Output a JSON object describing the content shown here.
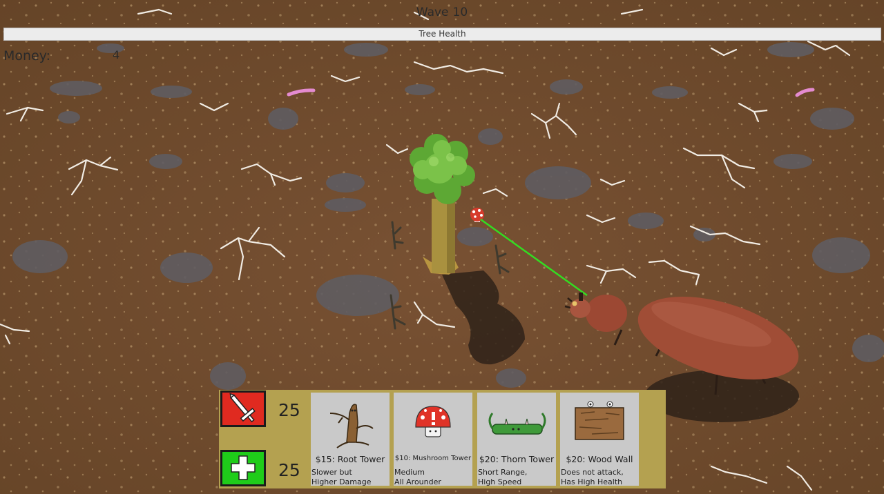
{
  "hud": {
    "wave_label": "Wave",
    "wave_number": "10",
    "tree_health_label": "Tree Health",
    "money_label": "Money:",
    "money_value": "4"
  },
  "upgrades": {
    "attack_value": "25",
    "health_value": "25",
    "attack_icon": "sword-icon",
    "health_icon": "plus-icon"
  },
  "towers": [
    {
      "title": "$15: Root Tower",
      "desc1": "Slower but",
      "desc2": "Higher Damage",
      "icon": "root-tower-icon"
    },
    {
      "title": "$10: Mushroom Tower",
      "desc1": "Medium",
      "desc2": "All Arounder",
      "icon": "mushroom-tower-icon"
    },
    {
      "title": "$20: Thorn Tower",
      "desc1": "Short Range,",
      "desc2": "High Speed",
      "icon": "thorn-tower-icon"
    },
    {
      "title": "$20: Wood Wall",
      "desc1": "Does not attack,",
      "desc2": "Has High Health",
      "icon": "wood-wall-icon"
    }
  ],
  "colors": {
    "ground": "#6e4a2c",
    "attack_button": "#e02a20",
    "health_button": "#1fcc1a",
    "panel": "#b4a150",
    "laser": "#33dd22"
  }
}
